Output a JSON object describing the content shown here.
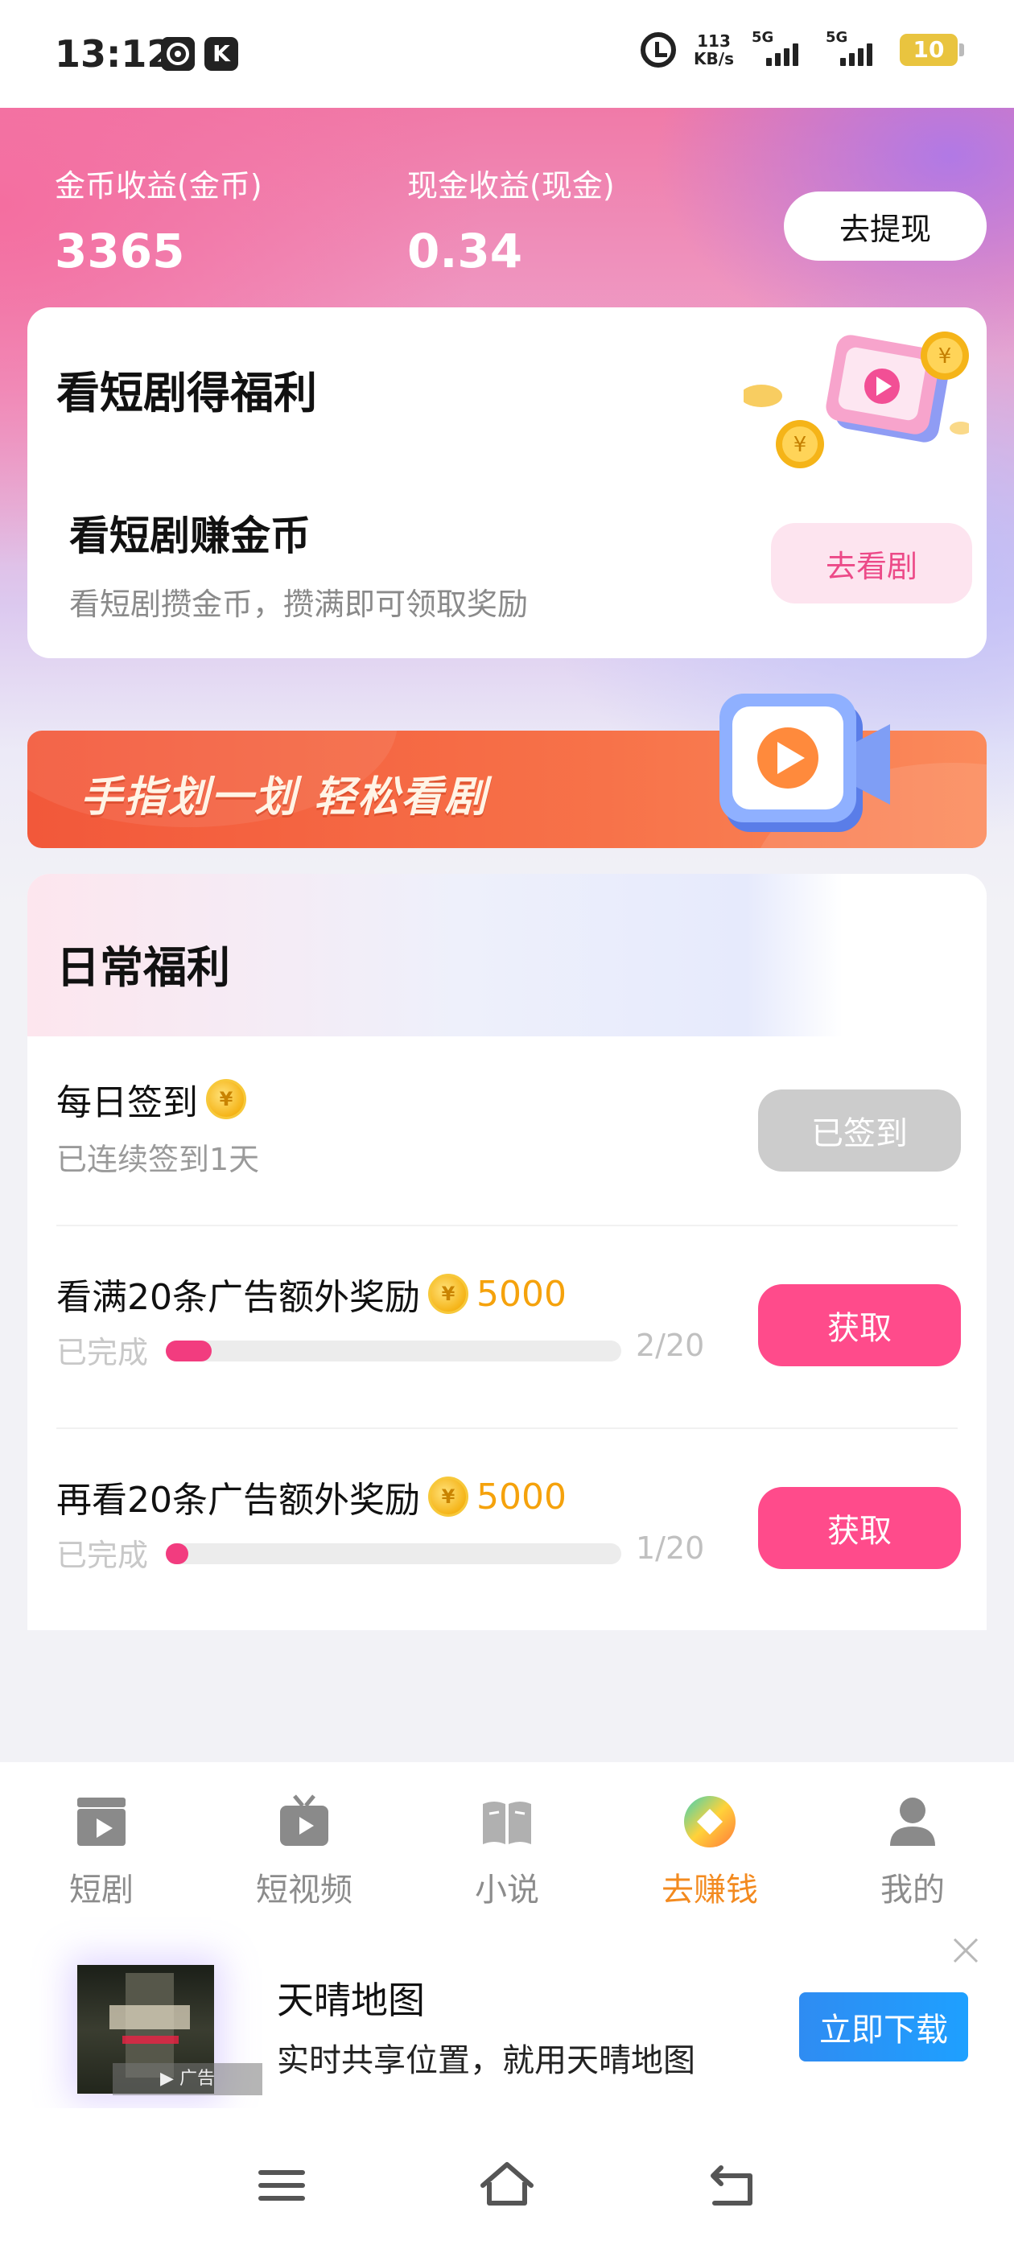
{
  "status_bar": {
    "time": "13:12",
    "app_icons": [
      "K"
    ],
    "speed": "113",
    "speed_unit": "KB/s",
    "signal1_label": "5G",
    "signal2_label": "5G",
    "battery": "10"
  },
  "earnings": {
    "coin_label": "金币收益(金币)",
    "coin_value": "3365",
    "cash_label": "现金收益(现金)",
    "cash_value": "0.34",
    "withdraw_label": "去提现"
  },
  "drama_card": {
    "title": "看短剧得福利",
    "subtitle": "看短剧赚金币",
    "desc": "看短剧攒金币，攒满即可领取奖励",
    "button": "去看剧"
  },
  "banner": {
    "text": "手指划一划 轻松看剧"
  },
  "daily": {
    "title": "日常福利",
    "tasks": [
      {
        "title": "每日签到",
        "sub": "已连续签到1天",
        "button": "已签到",
        "done": true
      },
      {
        "title": "看满20条广告额外奖励",
        "reward": "5000",
        "progress_label": "已完成",
        "progress_text": "2/20",
        "progress": 0.1,
        "button": "获取"
      },
      {
        "title": "再看20条广告额外奖励",
        "reward": "5000",
        "progress_label": "已完成",
        "progress_text": "1/20",
        "progress": 0.05,
        "button": "获取"
      }
    ]
  },
  "bottom_nav": {
    "items": [
      {
        "label": "短剧",
        "icon": "clapperboard-icon"
      },
      {
        "label": "短视频",
        "icon": "tv-play-icon"
      },
      {
        "label": "小说",
        "icon": "book-icon"
      },
      {
        "label": "去赚钱",
        "icon": "earn-diamond-icon",
        "active": true
      },
      {
        "label": "我的",
        "icon": "person-icon"
      }
    ]
  },
  "ad": {
    "title": "天晴地图",
    "desc": "实时共享位置，就用天晴地图",
    "button": "立即下载",
    "tag": "广告"
  },
  "colors": {
    "accent_pink": "#ff4b8b",
    "accent_orange": "#f38a1f",
    "reward_gold": "#f5a20c",
    "ad_blue": "#1ea0ff"
  }
}
